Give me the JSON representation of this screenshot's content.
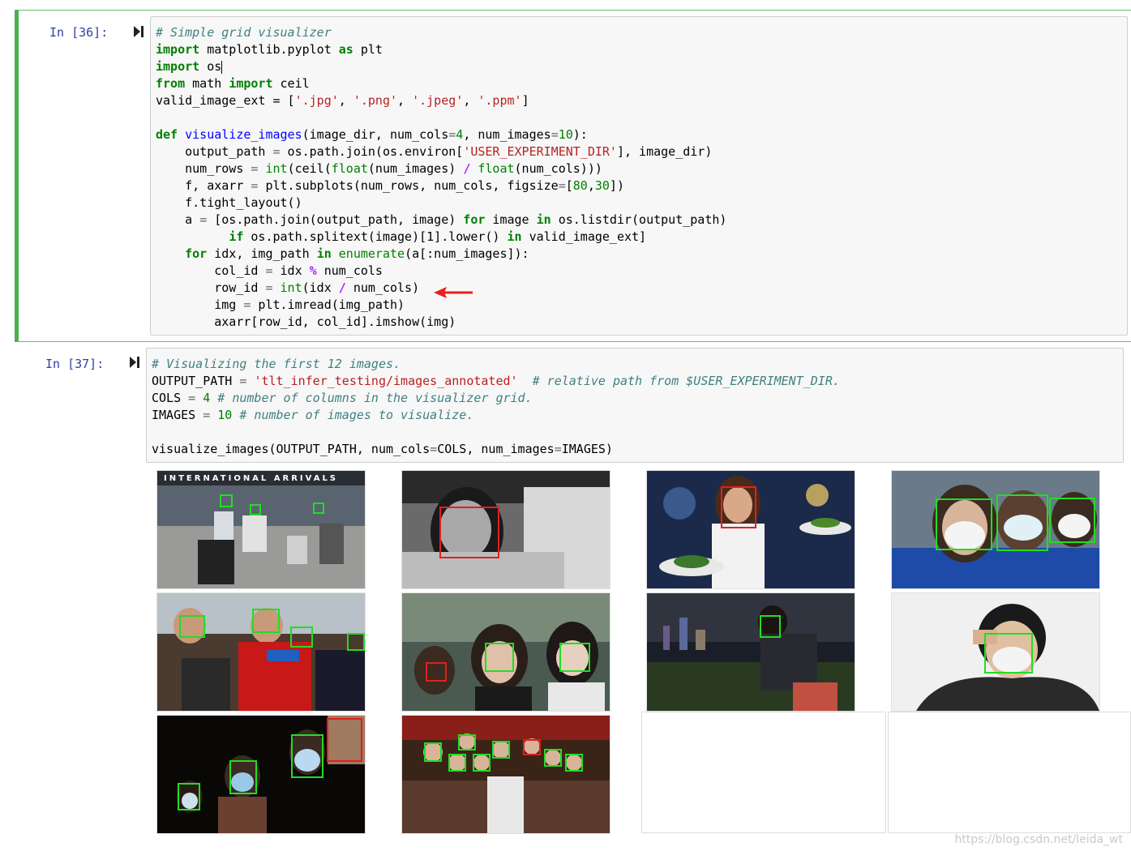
{
  "cells": [
    {
      "prompt": "In  [36]:",
      "code": {
        "comment1": "# Simple grid visualizer",
        "l2_kw": "import",
        "l2_rest": " matplotlib.pyplot ",
        "l2_as": "as",
        "l2_end": " plt",
        "l3_kw": "import",
        "l3_rest": " os",
        "l4_kw": "from",
        "l4_mid": " math ",
        "l4_kw2": "import",
        "l4_end": " ceil",
        "l5": "valid_image_ext = [",
        "l5_s1": "'.jpg'",
        "l5_s2": "'.png'",
        "l5_s3": "'.jpeg'",
        "l5_s4": "'.ppm'",
        "l7_def": "def",
        "l7_fn": "visualize_images",
        "l7_rest1": "(image_dir, num_cols",
        "l7_n1": "4",
        "l7_rest2": ", num_images",
        "l7_n2": "10",
        "l7_end": "):",
        "l8_a": "    output_path ",
        "l8_b": " os.path.join(os.environ[",
        "l8_s": "'USER_EXPERIMENT_DIR'",
        "l8_c": "], image_dir)",
        "l9_a": "    num_rows ",
        "l9_int": "int",
        "l9_b": "(ceil(",
        "l9_float": "float",
        "l9_c": "(num_images) ",
        "l9_float2": "float",
        "l9_d": "(num_cols)))",
        "l10_a": "    f, axarr ",
        "l10_b": " plt.subplots(num_rows, num_cols, figsize",
        "l10_c": "[",
        "l10_n1": "80",
        "l10_n2": "30",
        "l10_d": "])",
        "l11": "    f.tight_layout()",
        "l12_a": "    a ",
        "l12_b": " [os.path.join(output_path, image) ",
        "l12_for": "for",
        "l12_c": " image ",
        "l12_in": "in",
        "l12_d": " os.listdir(output_path)",
        "l13_if": "if",
        "l13_a": " os.path.splitext(image)[1].lower() ",
        "l13_in": "in",
        "l13_b": " valid_image_ext]",
        "l14_for": "for",
        "l14_a": " idx, img_path ",
        "l14_in": "in",
        "l14_en": "enumerate",
        "l14_b": "(a[:num_images]):",
        "l15_a": "        col_id ",
        "l15_b": " idx ",
        "l15_c": " num_cols",
        "l16_a": "        row_id ",
        "l16_int": "int",
        "l16_b": "(idx ",
        "l16_c": " num_cols)",
        "l17_a": "        img ",
        "l17_b": " plt.imread(img_path)",
        "l18": "        axarr[row_id, col_id].imshow(img)"
      }
    },
    {
      "prompt": "In  [37]:",
      "code": {
        "c1": "# Visualizing the first 12 images.",
        "l2_a": "OUTPUT_PATH ",
        "l2_s": "'tlt_infer_testing/images_annotated'",
        "l2_c": "# relative path from $USER_EXPERIMENT_DIR.",
        "l3_a": "COLS ",
        "l3_n": "4",
        "l3_c": "# number of columns in the visualizer grid.",
        "l4_a": "IMAGES ",
        "l4_n": "10",
        "l4_c": "# number of images to visualize.",
        "l6_a": "visualize_images(OUTPUT_PATH, num_cols",
        "l6_b": "COLS, num_images",
        "l6_c": "IMAGES)"
      }
    }
  ],
  "output": {
    "banner": "INTERNATIONAL ARRIVALS"
  },
  "watermark": "https://blog.csdn.net/leida_wt",
  "colors": {
    "cell_border_active": "#4caf50",
    "keyword": "#008000",
    "string": "#ba2121",
    "comment": "#408080",
    "box_green": "#22dd22",
    "box_red": "#e02020"
  }
}
